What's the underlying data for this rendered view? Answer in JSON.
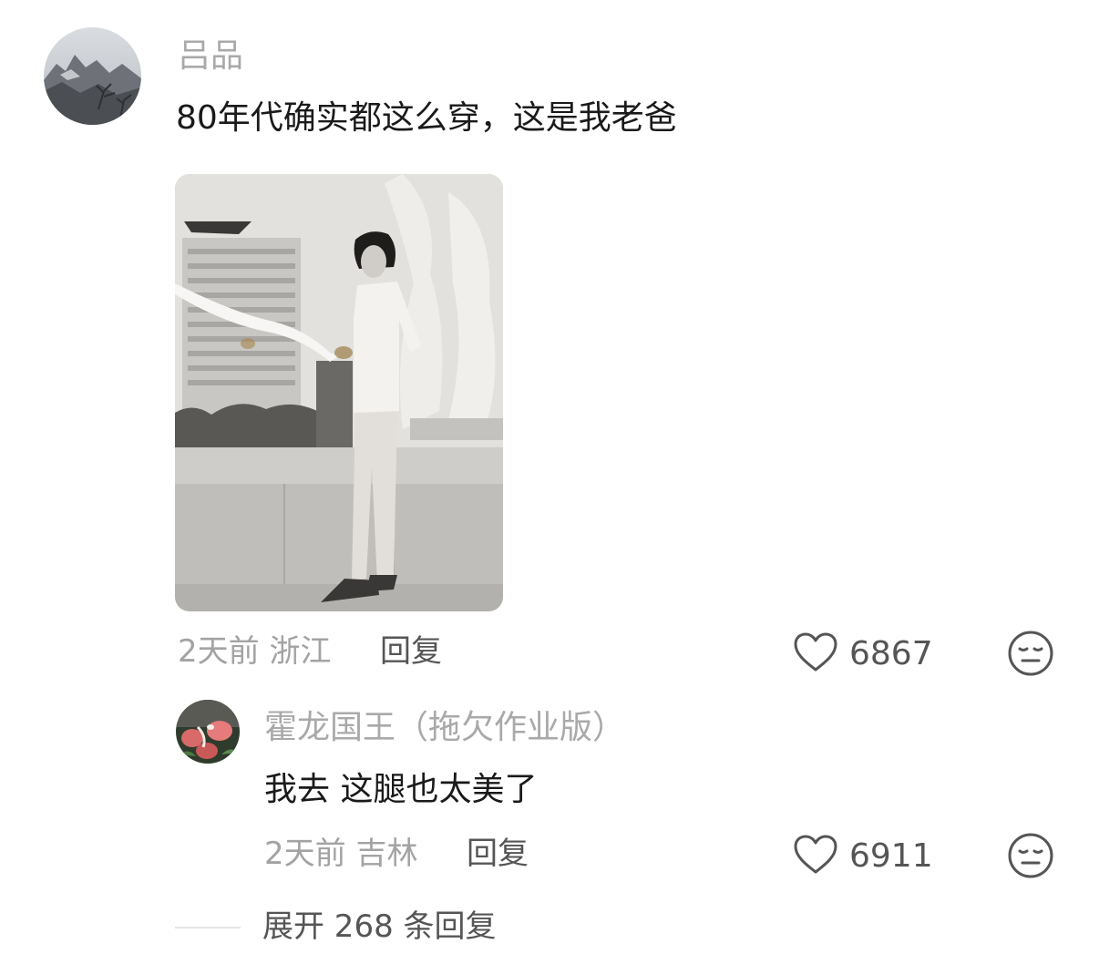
{
  "comment": {
    "username": "吕品",
    "text": "80年代确实都这么穿，这是我老爸",
    "meta": "2天前 浙江",
    "reply_label": "回复",
    "likes": "6867",
    "avatar_icon": "mountain-landscape-avatar",
    "photo_icon": "vintage-bw-photo"
  },
  "reply": {
    "username": "霍龙国王（拖欠作业版）",
    "text": "我去 这腿也太美了",
    "meta": "2天前 吉林",
    "reply_label": "回复",
    "likes": "6911",
    "avatar_icon": "flower-avatar"
  },
  "expand_label": "展开 268 条回复",
  "icons": {
    "like": "heart-outline-icon",
    "dislike": "meh-face-icon"
  },
  "colors": {
    "text": "#1a1a1a",
    "muted": "#a9a9a9",
    "secondary": "#555555"
  }
}
